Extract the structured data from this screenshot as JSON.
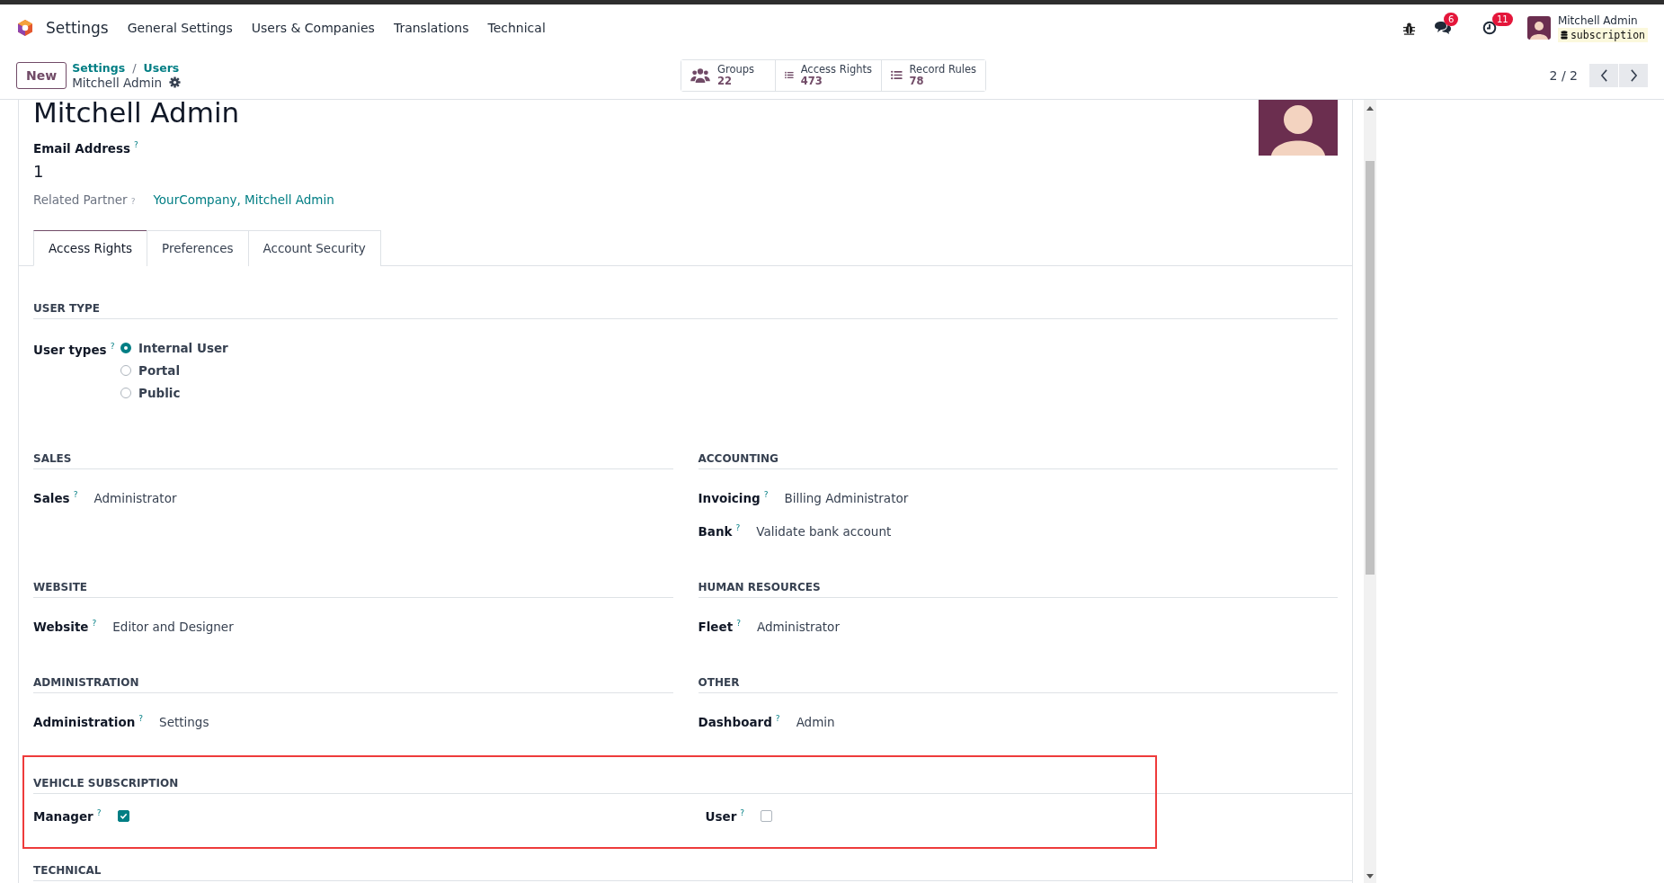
{
  "navbar": {
    "app": "Settings",
    "menu": [
      "General Settings",
      "Users & Companies",
      "Translations",
      "Technical"
    ],
    "chat_badge": "6",
    "activity_badge": "11",
    "user": {
      "name": "Mitchell Admin",
      "database": "subscription"
    }
  },
  "control_panel": {
    "new_button": "New",
    "breadcrumbs": [
      "Settings",
      "Users"
    ],
    "separator": "/",
    "record": "Mitchell Admin",
    "pager": "2 / 2",
    "smart_buttons": [
      {
        "kind": "groups",
        "label": "Groups",
        "count": "22"
      },
      {
        "kind": "list",
        "label": "Access Rights",
        "count": "473"
      },
      {
        "kind": "list",
        "label": "Record Rules",
        "count": "78"
      }
    ]
  },
  "form": {
    "name": "Mitchell Admin",
    "email_label": "Email Address",
    "email_help": "?",
    "email_value": "1",
    "partner_label": "Related Partner",
    "partner_help": "?",
    "partner_value": "YourCompany, Mitchell Admin",
    "tabs": [
      {
        "label": "Access Rights",
        "selected": true
      },
      {
        "label": "Preferences",
        "selected": false
      },
      {
        "label": "Account Security",
        "selected": false
      }
    ],
    "sections": [
      {
        "kind": "radio",
        "title": "USER TYPE",
        "label": "User types",
        "help": "?",
        "options": [
          {
            "label": "Internal User",
            "selected": true
          },
          {
            "label": "Portal",
            "selected": false
          },
          {
            "label": "Public",
            "selected": false
          }
        ]
      },
      {
        "kind": "pair",
        "columns": [
          {
            "title": "SALES",
            "fields": [
              {
                "kind": "text",
                "label": "Sales",
                "help": "?",
                "value": "Administrator"
              }
            ]
          },
          {
            "title": "ACCOUNTING",
            "fields": [
              {
                "kind": "text",
                "label": "Invoicing",
                "help": "?",
                "value": "Billing Administrator"
              },
              {
                "kind": "text",
                "label": "Bank",
                "help": "?",
                "value": "Validate bank account"
              }
            ]
          }
        ]
      },
      {
        "kind": "pair",
        "columns": [
          {
            "title": "WEBSITE",
            "fields": [
              {
                "kind": "text",
                "label": "Website",
                "help": "?",
                "value": "Editor and Designer"
              }
            ]
          },
          {
            "title": "HUMAN RESOURCES",
            "fields": [
              {
                "kind": "text",
                "label": "Fleet",
                "help": "?",
                "value": "Administrator"
              }
            ]
          }
        ]
      },
      {
        "kind": "pair",
        "columns": [
          {
            "title": "ADMINISTRATION",
            "fields": [
              {
                "kind": "text",
                "label": "Administration",
                "help": "?",
                "value": "Settings"
              }
            ]
          },
          {
            "title": "OTHER",
            "fields": [
              {
                "kind": "text",
                "label": "Dashboard",
                "help": "?",
                "value": "Admin"
              }
            ]
          }
        ]
      },
      {
        "kind": "split",
        "title": "VEHICLE SUBSCRIPTION",
        "highlighted": true,
        "fields": [
          {
            "kind": "checkbox",
            "label": "Manager",
            "help": "?",
            "checked": true
          },
          {
            "kind": "checkbox",
            "label": "User",
            "help": "?",
            "checked": false
          }
        ]
      },
      {
        "kind": "split",
        "title": "TECHNICAL",
        "highlighted": false
      }
    ]
  }
}
